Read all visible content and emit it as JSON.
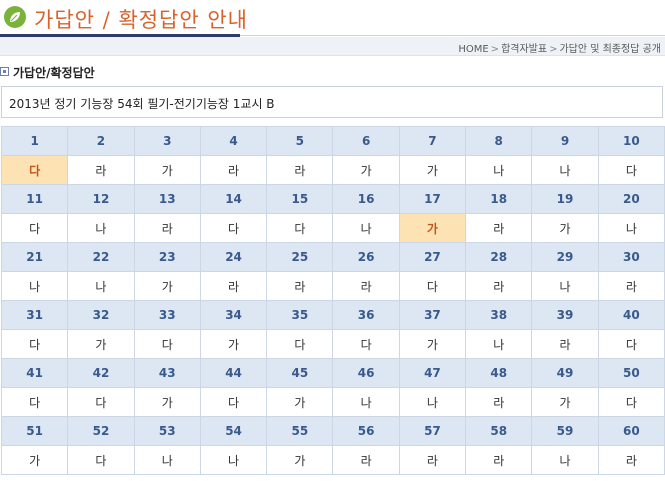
{
  "banner": {
    "title": "가답안 / 확정답안 안내",
    "icon": "leaf-icon",
    "accent_color": "#d9622c",
    "bar_color": "#2f3c6b"
  },
  "breadcrumb": {
    "items": [
      "HOME",
      "합격자발표",
      "가답안 및 최종정답 공개"
    ],
    "separator": ">"
  },
  "section": {
    "title": "가답안/확정답안"
  },
  "exam": {
    "title": "2013년 정기 기능장 54회 필기-전기기능장 1교시 B"
  },
  "answers": {
    "header_color": "#dde6f3",
    "highlight_color": "#fde3b4",
    "rows": [
      {
        "numbers": [
          "1",
          "2",
          "3",
          "4",
          "5",
          "6",
          "7",
          "8",
          "9",
          "10"
        ],
        "answers": [
          "다",
          "라",
          "가",
          "라",
          "라",
          "가",
          "가",
          "나",
          "나",
          "다"
        ],
        "highlight": [
          0
        ]
      },
      {
        "numbers": [
          "11",
          "12",
          "13",
          "14",
          "15",
          "16",
          "17",
          "18",
          "19",
          "20"
        ],
        "answers": [
          "다",
          "나",
          "라",
          "다",
          "다",
          "나",
          "가",
          "라",
          "가",
          "나"
        ],
        "highlight": [
          6
        ]
      },
      {
        "numbers": [
          "21",
          "22",
          "23",
          "24",
          "25",
          "26",
          "27",
          "28",
          "29",
          "30"
        ],
        "answers": [
          "나",
          "나",
          "가",
          "라",
          "라",
          "라",
          "다",
          "라",
          "나",
          "라"
        ],
        "highlight": []
      },
      {
        "numbers": [
          "31",
          "32",
          "33",
          "34",
          "35",
          "36",
          "37",
          "38",
          "39",
          "40"
        ],
        "answers": [
          "다",
          "가",
          "다",
          "가",
          "다",
          "다",
          "가",
          "나",
          "라",
          "다"
        ],
        "highlight": []
      },
      {
        "numbers": [
          "41",
          "42",
          "43",
          "44",
          "45",
          "46",
          "47",
          "48",
          "49",
          "50"
        ],
        "answers": [
          "다",
          "다",
          "가",
          "다",
          "가",
          "나",
          "나",
          "라",
          "가",
          "다"
        ],
        "highlight": []
      },
      {
        "numbers": [
          "51",
          "52",
          "53",
          "54",
          "55",
          "56",
          "57",
          "58",
          "59",
          "60"
        ],
        "answers": [
          "가",
          "다",
          "나",
          "나",
          "가",
          "라",
          "라",
          "라",
          "나",
          "라"
        ],
        "highlight": []
      }
    ]
  }
}
